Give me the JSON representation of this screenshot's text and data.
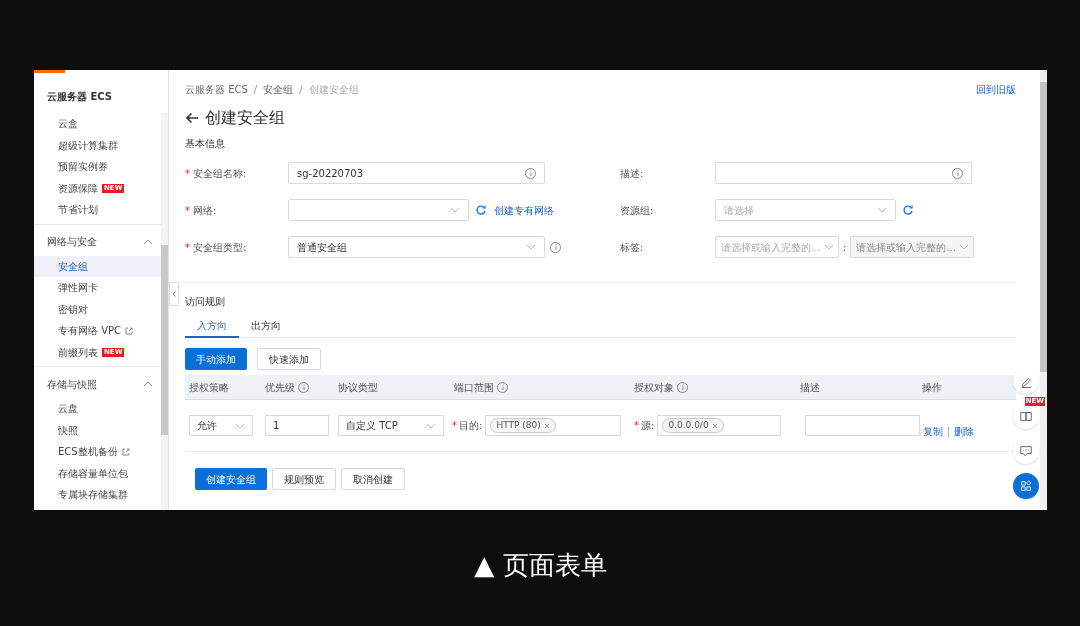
{
  "sidebar": {
    "title": "云服务器 ECS",
    "groups": [
      {
        "items": [
          {
            "label": "云盒",
            "selected": false
          },
          {
            "label": "超级计算集群",
            "selected": false
          },
          {
            "label": "预留实例券",
            "selected": false
          },
          {
            "label": "资源保障",
            "selected": false,
            "badge": "NEW"
          },
          {
            "label": "节省计划",
            "selected": false
          }
        ]
      },
      {
        "heading": "网络与安全",
        "expanded": true,
        "items": [
          {
            "label": "安全组",
            "selected": true
          },
          {
            "label": "弹性网卡",
            "selected": false
          },
          {
            "label": "密钥对",
            "selected": false
          },
          {
            "label": "专有网络 VPC",
            "selected": false,
            "external": true
          },
          {
            "label": "前缀列表",
            "selected": false,
            "badge": "NEW"
          }
        ]
      },
      {
        "heading": "存储与快照",
        "expanded": true,
        "items": [
          {
            "label": "云盘",
            "selected": false
          },
          {
            "label": "快照",
            "selected": false
          },
          {
            "label": "ECS整机备份",
            "selected": false,
            "external": true
          },
          {
            "label": "存储容量单位包",
            "selected": false
          },
          {
            "label": "专属块存储集群",
            "selected": false
          }
        ]
      }
    ]
  },
  "breadcrumb": {
    "separator": "/",
    "items": [
      "云服务器 ECS",
      "安全组",
      "创建安全组"
    ]
  },
  "old_version_link": "回到旧版",
  "title": "创建安全组",
  "required_mark": "*",
  "basic_info": {
    "heading": "基本信息",
    "fields": [
      {
        "label": "安全组名称:",
        "required": true,
        "kind": "input",
        "value": "sg-20220703",
        "info": true
      },
      {
        "label": "描述:",
        "required": false,
        "kind": "input",
        "info": true
      },
      {
        "label": "网络:",
        "required": true,
        "kind": "select",
        "refresh": true,
        "link": "创建专有网络"
      },
      {
        "label": "资源组:",
        "required": false,
        "kind": "select",
        "placeholder": "请选择",
        "refresh": true
      },
      {
        "label": "安全组类型:",
        "required": true,
        "kind": "select",
        "value": "普通安全组",
        "info_outside": true
      },
      {
        "label": "标签:",
        "required": false,
        "kind": "tags",
        "separator": ":",
        "placeholders": [
          "请选择或输入完整的...",
          "请选择或输入完整的..."
        ]
      }
    ]
  },
  "access_rules": {
    "heading": "访问规则",
    "tabs": [
      {
        "label": "入方向",
        "selected": true
      },
      {
        "label": "出方向",
        "selected": false
      }
    ],
    "buttons": [
      {
        "label": "手动添加",
        "primary": true
      },
      {
        "label": "快速添加",
        "primary": false
      }
    ],
    "table": {
      "columns": [
        {
          "label": "授权策略",
          "info": false
        },
        {
          "label": "优先级",
          "info": true
        },
        {
          "label": "协议类型",
          "info": false
        },
        {
          "label": "端口范围",
          "info": true
        },
        {
          "label": "授权对象",
          "info": true
        },
        {
          "label": "描述",
          "info": false
        },
        {
          "label": "操作",
          "info": false
        }
      ],
      "rows": [
        {
          "policy": "允许",
          "priority": "1",
          "protocol": "自定义 TCP",
          "port_label": "目的:",
          "port_tag": "HTTP (80)",
          "source_label": "源:",
          "source_tag": "0.0.0.0/0",
          "actions": [
            "复制",
            "删除"
          ],
          "action_separator": "|"
        }
      ]
    }
  },
  "footer_buttons": [
    {
      "label": "创建安全组",
      "primary": true
    },
    {
      "label": "规则预览",
      "primary": false
    },
    {
      "label": "取消创建",
      "primary": false
    }
  ],
  "floating_tools": [
    {
      "kind": "edit"
    },
    {
      "kind": "book",
      "badge": "NEW"
    },
    {
      "kind": "chat"
    },
    {
      "kind": "apps"
    }
  ],
  "caption": "▲ 页面表单"
}
